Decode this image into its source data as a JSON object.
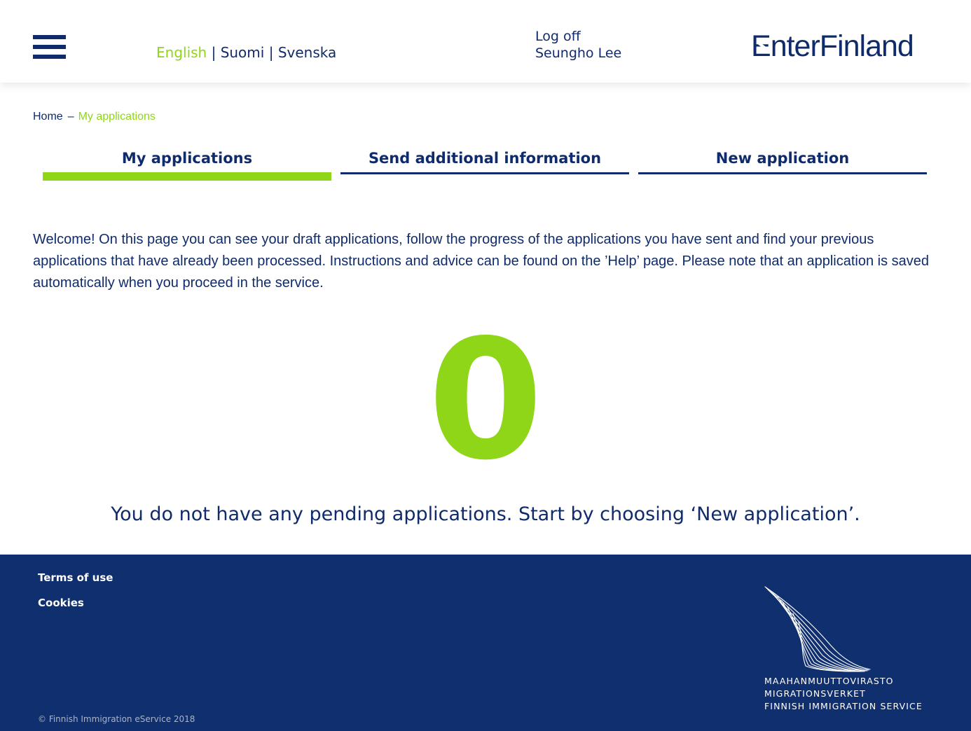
{
  "header": {
    "languages": [
      {
        "label": "English",
        "active": true
      },
      {
        "label": "Suomi",
        "active": false
      },
      {
        "label": "Svenska",
        "active": false
      }
    ],
    "separator": "|",
    "logoff_label": "Log off",
    "user_name": "Seungho Lee",
    "brand": {
      "first_letter": "E",
      "rest": "nterFinland"
    }
  },
  "breadcrumb": {
    "home": "Home",
    "dash": "–",
    "current": "My applications"
  },
  "tabs": [
    {
      "label": "My applications",
      "active": true
    },
    {
      "label": "Send additional information",
      "active": false
    },
    {
      "label": "New application",
      "active": false
    }
  ],
  "main": {
    "intro": "Welcome! On this page you can see your draft applications, follow the progress of the applications you have sent and find your previous applications that have already been processed. Instructions and advice can be found on the ’Help’ page. Please note that an application is saved automatically when you proceed in the service.",
    "pending_count": "0",
    "empty_message": "You do not have any pending applications. Start by choosing ‘New application’."
  },
  "footer": {
    "links": [
      {
        "label": "Terms of use"
      },
      {
        "label": "Cookies"
      }
    ],
    "copyright": "© Finnish Immigration eService 2018",
    "agency_lines": [
      "MAAHANMUUTTOVIRASTO",
      "MIGRATIONSVERKET",
      "FINNISH IMMIGRATION SERVICE"
    ]
  },
  "icons": {
    "menu": "hamburger-menu-icon",
    "agency_logo": "migri-wing-logo-icon"
  },
  "colors": {
    "navy": "#0f2b6b",
    "accent_green": "#8fd619",
    "footer_bg": "#0f2f6e",
    "background": "#ffffff"
  }
}
